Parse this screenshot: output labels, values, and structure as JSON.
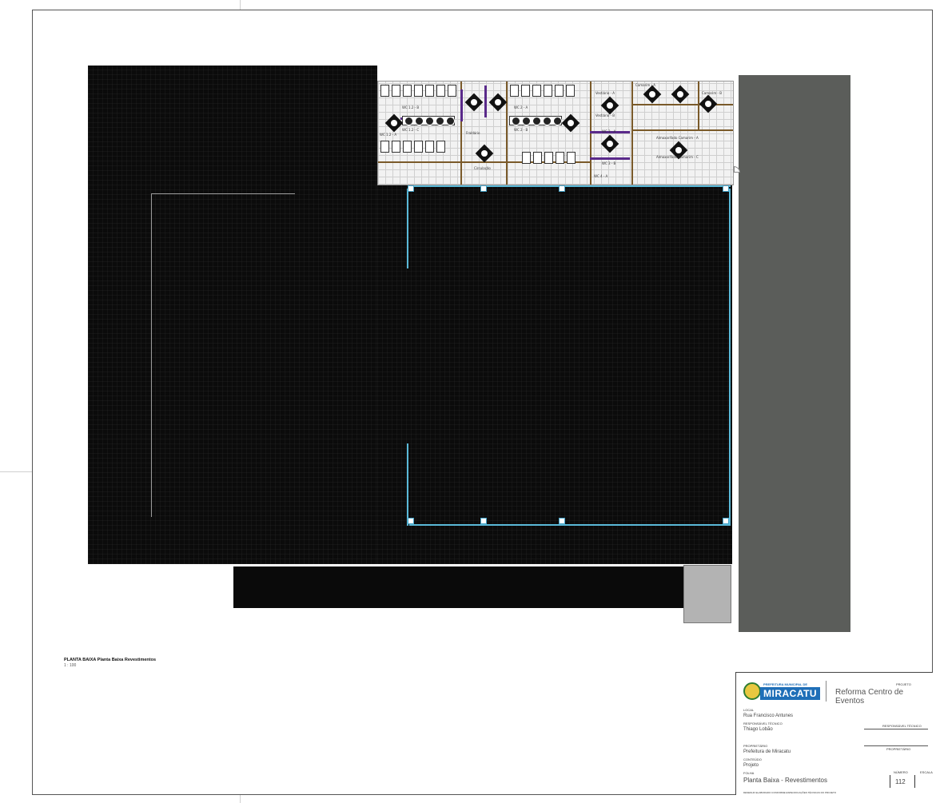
{
  "view": {
    "title": "PLANTA BAIXA Planta Baixa Revestimentos",
    "scale": "1 : 100"
  },
  "plan": {
    "room_labels": [
      "WC 1.2 - A",
      "WC 1.2 - B",
      "WC 1.2 - C",
      "WC 2 - A",
      "WC 2 - B",
      "Fraldário",
      "Vestiário - A",
      "Vestiário - B",
      "Camarim - A",
      "Camarim - B",
      "Circulação",
      "Almoxarifado Camarim - A",
      "Almoxarifado Camarim - C",
      "WC 3 - A",
      "WC 3 - B",
      "WC 4 - A"
    ]
  },
  "title_block": {
    "logo_top": "PREFEITURA MUNICIPAL DE",
    "logo_name": "MIRACATU",
    "project_label": "Projeto",
    "project_name": "Reforma Centro de Eventos",
    "location_label": "Local",
    "location_value": "Rua Francisco Antunes",
    "responsible_label": "Responsável técnico",
    "responsible_value": "Thiago Lobão",
    "signature_label": "Responsável técnico",
    "owner_label": "Proprietário",
    "owner_value": "Prefeitura de Miracatu",
    "owner_signature_label": "Proprietário",
    "content_label": "Conteúdo",
    "content_value": "Projeto",
    "sheet_label": "Folha",
    "sheet_name": "Planta Baixa - Revestimentos",
    "sheet_number_label": "Número",
    "sheet_number": "112",
    "scale_label": "Escala",
    "footer_note": "Desenho elaborado conforme especificações técnicas do projeto"
  }
}
